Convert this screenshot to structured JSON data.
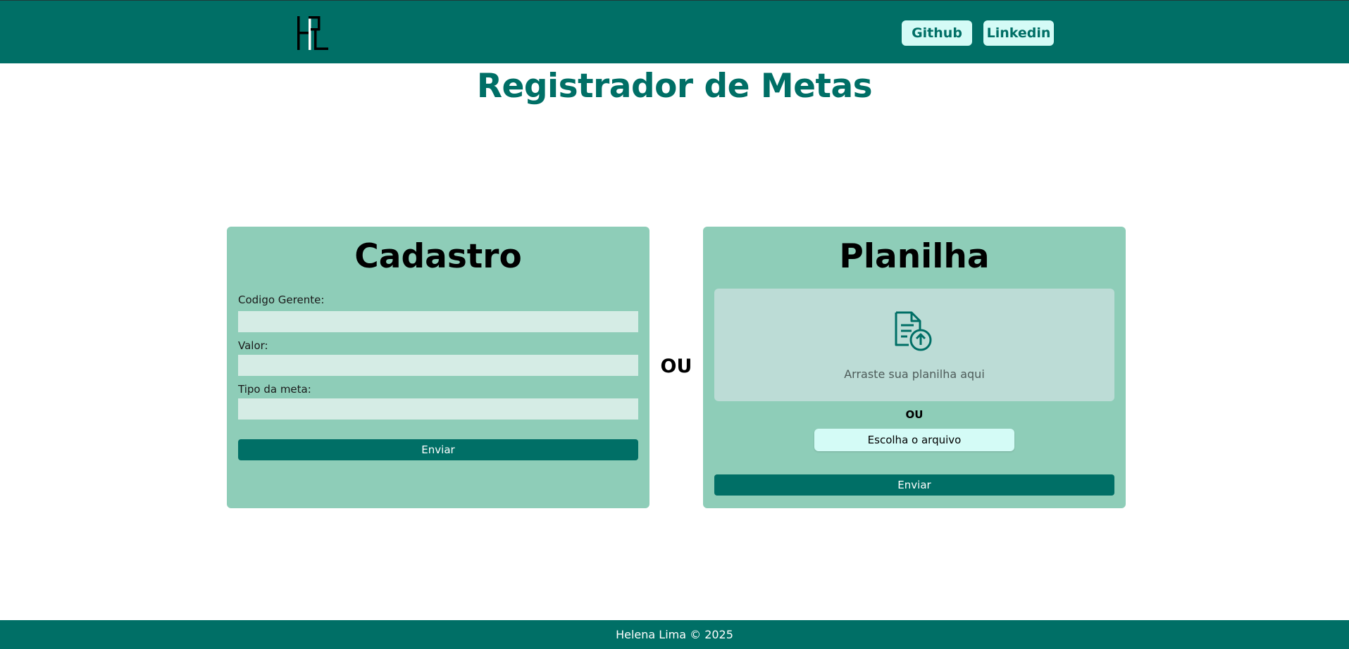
{
  "header": {
    "logo_text": "HPL",
    "nav": [
      {
        "label": "Github"
      },
      {
        "label": "Linkedin"
      }
    ]
  },
  "page": {
    "title": "Registrador de Metas",
    "separator": "OU"
  },
  "cadastro": {
    "title": "Cadastro",
    "fields": [
      {
        "label": "Codigo Gerente:",
        "value": "",
        "placeholder": ""
      },
      {
        "label": "Valor:",
        "value": "",
        "placeholder": ""
      },
      {
        "label": "Tipo da meta:",
        "value": "",
        "placeholder": ""
      }
    ],
    "submit_label": "Enviar"
  },
  "planilha": {
    "title": "Planilha",
    "dropzone_text": "Arraste sua planilha aqui",
    "dropzone_icon": "file-upload-icon",
    "separator": "OU",
    "choose_label": "Escolha o arquivo",
    "submit_label": "Enviar"
  },
  "footer": {
    "text": "Helena Lima © 2025"
  },
  "colors": {
    "primary": "#006f66",
    "card": "#8ecdb8",
    "input": "#d5ece5",
    "dropzone": "#bcdcd6",
    "button_light": "#d4fbf6"
  }
}
